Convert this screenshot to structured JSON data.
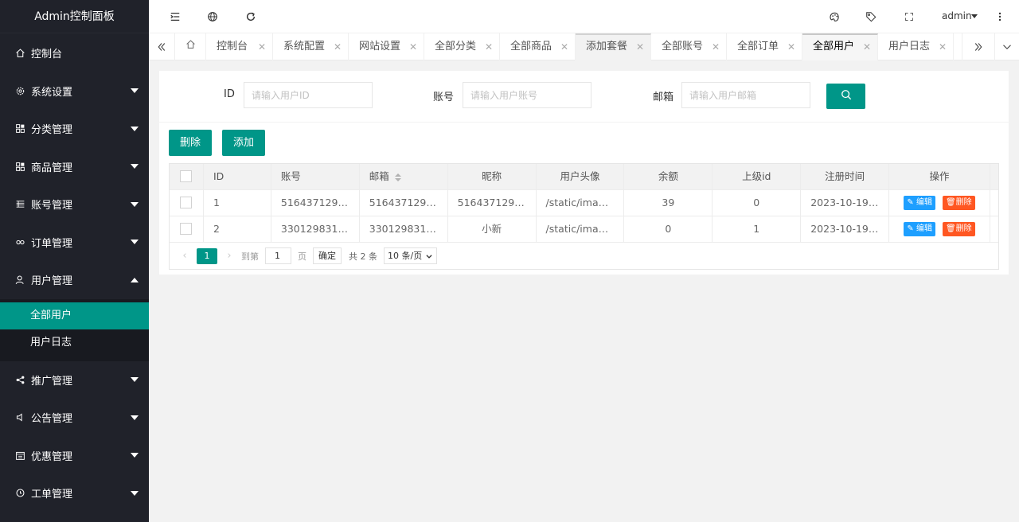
{
  "app": {
    "title": "Admin控制面板",
    "user": "admin"
  },
  "sidebar": {
    "items": [
      {
        "label": "控制台",
        "icon": "home-icon",
        "has_caret": false
      },
      {
        "label": "系统设置",
        "icon": "gear-icon",
        "has_caret": true
      },
      {
        "label": "分类管理",
        "icon": "apps-icon",
        "has_caret": true
      },
      {
        "label": "商品管理",
        "icon": "apps-icon",
        "has_caret": true
      },
      {
        "label": "账号管理",
        "icon": "list-icon",
        "has_caret": true
      },
      {
        "label": "订单管理",
        "icon": "link-icon",
        "has_caret": true
      },
      {
        "label": "用户管理",
        "icon": "user-icon",
        "has_caret": true,
        "expanded": true
      }
    ],
    "submenu": [
      {
        "label": "全部用户",
        "active": true
      },
      {
        "label": "用户日志",
        "active": false
      }
    ],
    "items_after": [
      {
        "label": "推广管理",
        "icon": "share-icon"
      },
      {
        "label": "公告管理",
        "icon": "speaker-icon"
      },
      {
        "label": "优惠管理",
        "icon": "calendar-icon"
      },
      {
        "label": "工单管理",
        "icon": "clock-icon"
      }
    ]
  },
  "header": {
    "icons_left": [
      "menu-fold-icon",
      "globe-icon",
      "refresh-icon"
    ],
    "icons_right": [
      "palette-icon",
      "tag-icon",
      "fullscreen-icon",
      "more-vertical-icon"
    ]
  },
  "tabs": [
    {
      "label": "控制台",
      "closable": false
    },
    {
      "label": "系统配置",
      "closable": true
    },
    {
      "label": "网站设置",
      "closable": true
    },
    {
      "label": "全部分类",
      "closable": true
    },
    {
      "label": "全部商品",
      "closable": true
    },
    {
      "label": "添加套餐",
      "closable": true
    },
    {
      "label": "全部账号",
      "closable": true
    },
    {
      "label": "全部订单",
      "closable": true
    },
    {
      "label": "全部用户",
      "closable": true
    },
    {
      "label": "用户日志",
      "closable": true
    }
  ],
  "search_form": {
    "id_label": "ID",
    "id_placeholder": "请输入用户ID",
    "account_label": "账号",
    "account_placeholder": "请输入用户账号",
    "email_label": "邮箱",
    "email_placeholder": "请输入用户邮箱"
  },
  "actions": {
    "delete": "删除",
    "add": "添加"
  },
  "table": {
    "columns": [
      "ID",
      "账号",
      "邮箱",
      "昵称",
      "用户头像",
      "余额",
      "上级id",
      "注册时间",
      "操作"
    ],
    "rows": [
      {
        "id": "1",
        "account": "516437129@...",
        "email": "516437129@...",
        "nickname": "516437129@...",
        "avatar": "/static/images...",
        "balance": "39",
        "parent_id": "0",
        "reg_time": "2023-10-19 1..."
      },
      {
        "id": "2",
        "account": "3301298315...",
        "email": "3301298315...",
        "nickname": "小新",
        "avatar": "/static/images...",
        "balance": "0",
        "parent_id": "1",
        "reg_time": "2023-10-19 1..."
      }
    ],
    "row_actions": {
      "edit": "编辑",
      "delete": "删除"
    }
  },
  "pager": {
    "current": "1",
    "goto_label": "到第",
    "goto_value": "1",
    "page_suffix": "页",
    "confirm": "确定",
    "total": "共 2 条",
    "page_size": "10 条/页"
  },
  "colors": {
    "accent": "#009688",
    "sidebar_bg": "#20222a",
    "edit": "#1e9fff",
    "danger": "#ff5722"
  }
}
